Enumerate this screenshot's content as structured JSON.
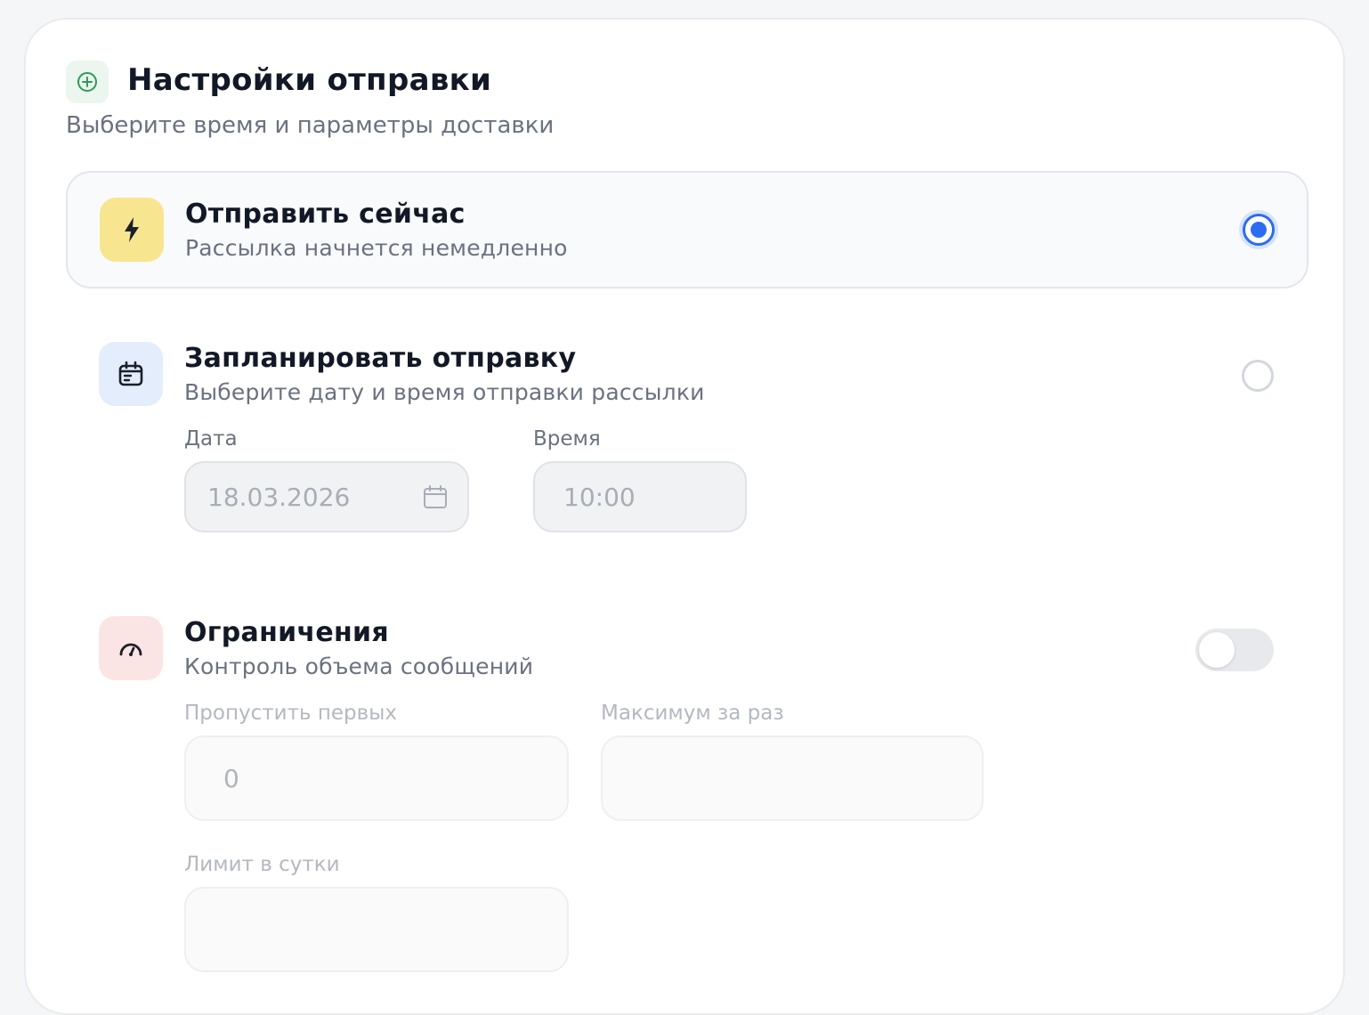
{
  "header": {
    "title": "Настройки отправки",
    "subtitle": "Выберите время и параметры доставки",
    "icon": "plus-circle-icon"
  },
  "options": {
    "send_now": {
      "title": "Отправить сейчас",
      "description": "Рассылка начнется немедленно",
      "icon": "lightning-icon",
      "selected": true
    },
    "schedule": {
      "title": "Запланировать отправку",
      "description": "Выберите дату и время отправки рассылки",
      "icon": "calendar-icon",
      "selected": false,
      "date_label": "Дата",
      "date_value": "18.03.2026",
      "time_label": "Время",
      "time_value": "10:00"
    }
  },
  "limits": {
    "title": "Ограничения",
    "description": "Контроль объема сообщений",
    "icon": "gauge-icon",
    "enabled": false,
    "skip_first_label": "Пропустить первых",
    "skip_first_value": "0",
    "max_per_batch_label": "Максимум за раз",
    "max_per_batch_value": "",
    "daily_limit_label": "Лимит в сутки",
    "daily_limit_value": ""
  },
  "colors": {
    "accent": "#2d6cf0",
    "send_now_tile": "#f8e58f",
    "schedule_tile": "#e3edfb",
    "limits_tile": "#fbe4e4",
    "header_tile": "#eaf6ee"
  }
}
